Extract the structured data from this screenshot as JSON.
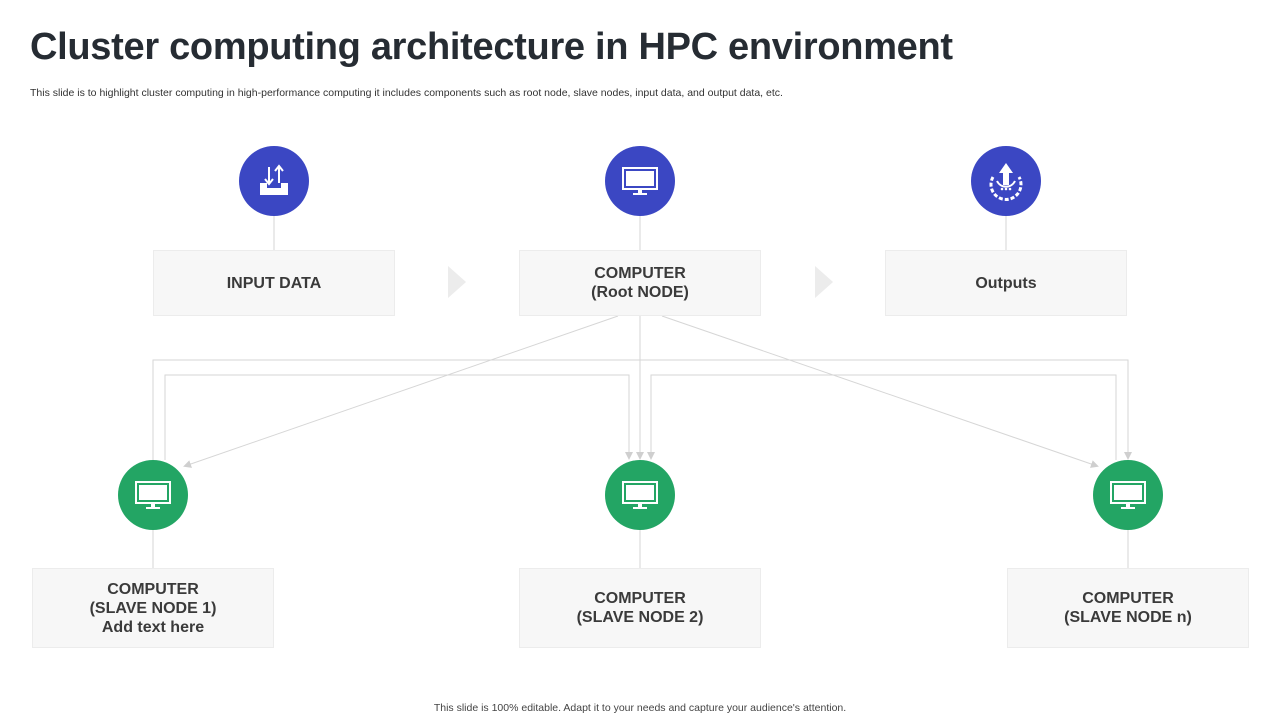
{
  "header": {
    "title": "Cluster computing architecture in HPC environment",
    "subtitle": "This slide is to highlight cluster computing in high-performance computing it includes components such as root node, slave nodes, input data, and output data, etc."
  },
  "top_nodes": {
    "input": {
      "label": "INPUT DATA",
      "icon": "upload-download-icon"
    },
    "root": {
      "line1": "COMPUTER",
      "line2": "(Root NODE)",
      "icon": "monitor-icon"
    },
    "outputs": {
      "label": "Outputs",
      "icon": "rocket-gear-icon"
    }
  },
  "slave_nodes": {
    "node1": {
      "line1": "COMPUTER",
      "line2": "(SLAVE NODE 1)",
      "line3": "Add text  here",
      "icon": "monitor-icon"
    },
    "node2": {
      "line1": "COMPUTER",
      "line2": "(SLAVE NODE 2)",
      "icon": "monitor-icon"
    },
    "noden": {
      "line1": "COMPUTER",
      "line2": "(SLAVE NODE n)",
      "icon": "monitor-icon"
    }
  },
  "colors": {
    "top_circle": "#3b47c3",
    "slave_circle": "#23a564",
    "box_bg": "#f7f7f7",
    "connector": "#d6d6d6"
  },
  "footer": {
    "text": "This slide is 100% editable. Adapt it to your needs and capture your audience's attention."
  }
}
